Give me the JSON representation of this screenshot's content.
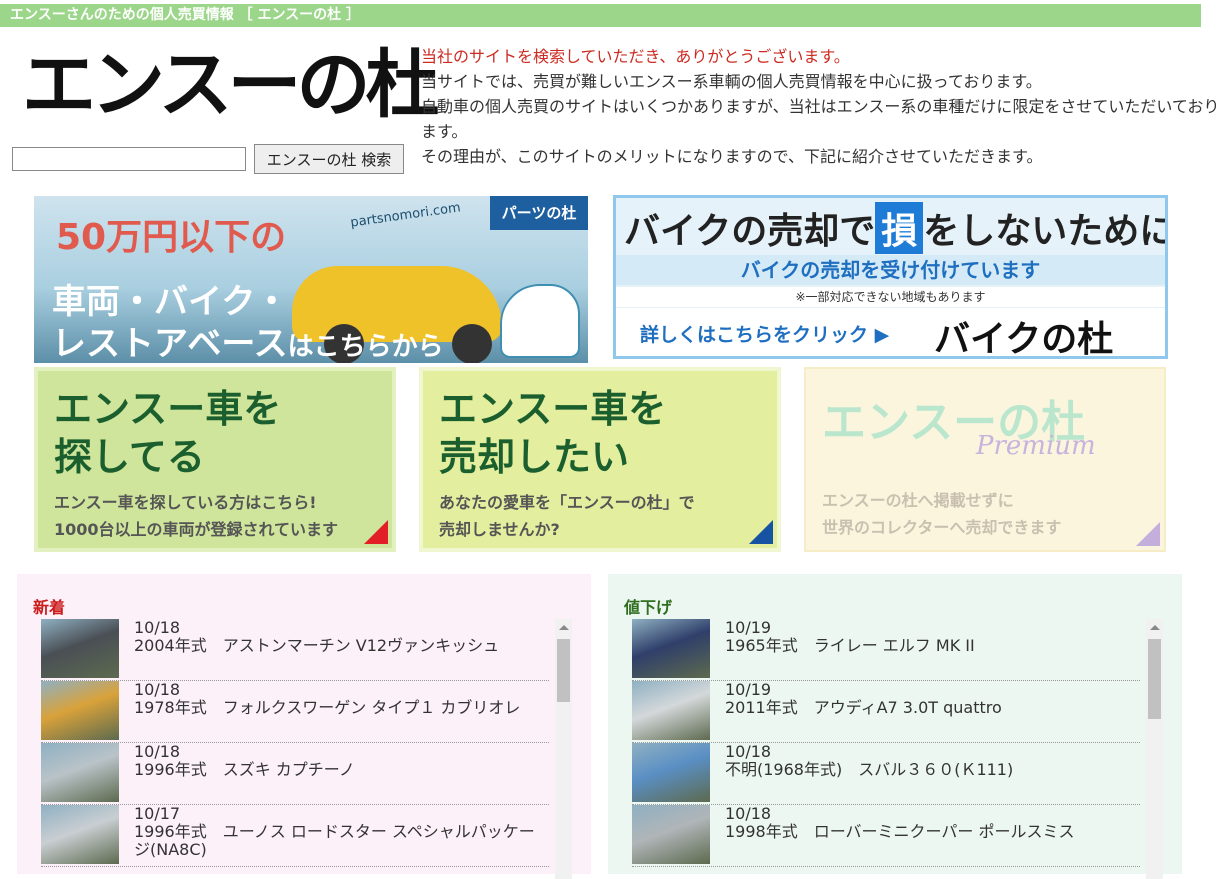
{
  "header": {
    "bar_text": "エンスーさんのための個人売買情報 ［ エンスーの杜 ］"
  },
  "logo": {
    "text": "エンスーの杜"
  },
  "search": {
    "placeholder": "",
    "button_label": "エンスーの杜 検索"
  },
  "intro": {
    "line1": "当社のサイトを検索していただき、ありがとうございます。",
    "line2": "当サイトでは、売買が難しいエンスー系車輌の個人売買情報を中心に扱っております。",
    "line3": "自動車の個人売買のサイトはいくつかありますが、当社はエンスー系の車種だけに限定をさせていただいております。",
    "line4": "その理由が、このサイトのメリットになりますので、下記に紹介させていただきます。"
  },
  "banners": {
    "parts": {
      "price_num": "50万円",
      "price_suffix": "以下の",
      "line2": "車両・バイク・",
      "line3_main": "レストアベース",
      "line3_suffix": "はこちらから",
      "tag": "パーツの杜",
      "url": "partsnomori.com"
    },
    "bike": {
      "head_before": "バイクの売却で",
      "head_box": "損",
      "head_after": "をしないために",
      "sub": "バイクの売却を受け付けています",
      "note": "※一部対応できない地域もあります",
      "click": "詳しくはこちらをクリック ▶",
      "brand": "バイクの杜"
    }
  },
  "tiles": {
    "search": {
      "title_1": "エンスー車を",
      "title_2": "探してる",
      "desc_1": "エンスー車を探している方はこちら!",
      "desc_2": "1000台以上の車両が登録されています"
    },
    "sell": {
      "title_1": "エンスー車を",
      "title_2": "売却したい",
      "desc_1": "あなたの愛車を「エンスーの杜」で",
      "desc_2": "売却しませんか?"
    },
    "premium": {
      "title": "エンスーの杜",
      "sub": "Premium",
      "desc_1": "エンスーの杜へ掲載せずに",
      "desc_2": "世界のコレクターへ売却できます"
    }
  },
  "new_arrivals": {
    "title": "新着",
    "items": [
      {
        "date": "10/18",
        "name": "2004年式　アストンマーチン V12ヴァンキッシュ",
        "thumb_color": "#4a4f55"
      },
      {
        "date": "10/18",
        "name": "1978年式　フォルクスワーゲン タイプ１ カブリオレ",
        "thumb_color": "#d9a23a"
      },
      {
        "date": "10/18",
        "name": "1996年式　スズキ カプチーノ",
        "thumb_color": "#b9c3c8"
      },
      {
        "date": "10/17",
        "name": "1996年式　ユーノス ロードスター スペシャルパッケージ(NA8C)",
        "thumb_color": "#c9ced2"
      }
    ]
  },
  "price_drops": {
    "title": "値下げ",
    "items": [
      {
        "date": "10/19",
        "name": "1965年式　ライレー エルフ MK II",
        "thumb_color": "#2f3f6a"
      },
      {
        "date": "10/19",
        "name": "2011年式　アウディA7 3.0T quattro",
        "thumb_color": "#d4d8da"
      },
      {
        "date": "10/18",
        "name": "不明(1968年式)　スバル３６０(Ｋ111)",
        "thumb_color": "#5a8fc4"
      },
      {
        "date": "10/18",
        "name": "1998年式　ローバーミニクーパー ポールスミス",
        "thumb_color": "#b0b5b8"
      }
    ]
  }
}
